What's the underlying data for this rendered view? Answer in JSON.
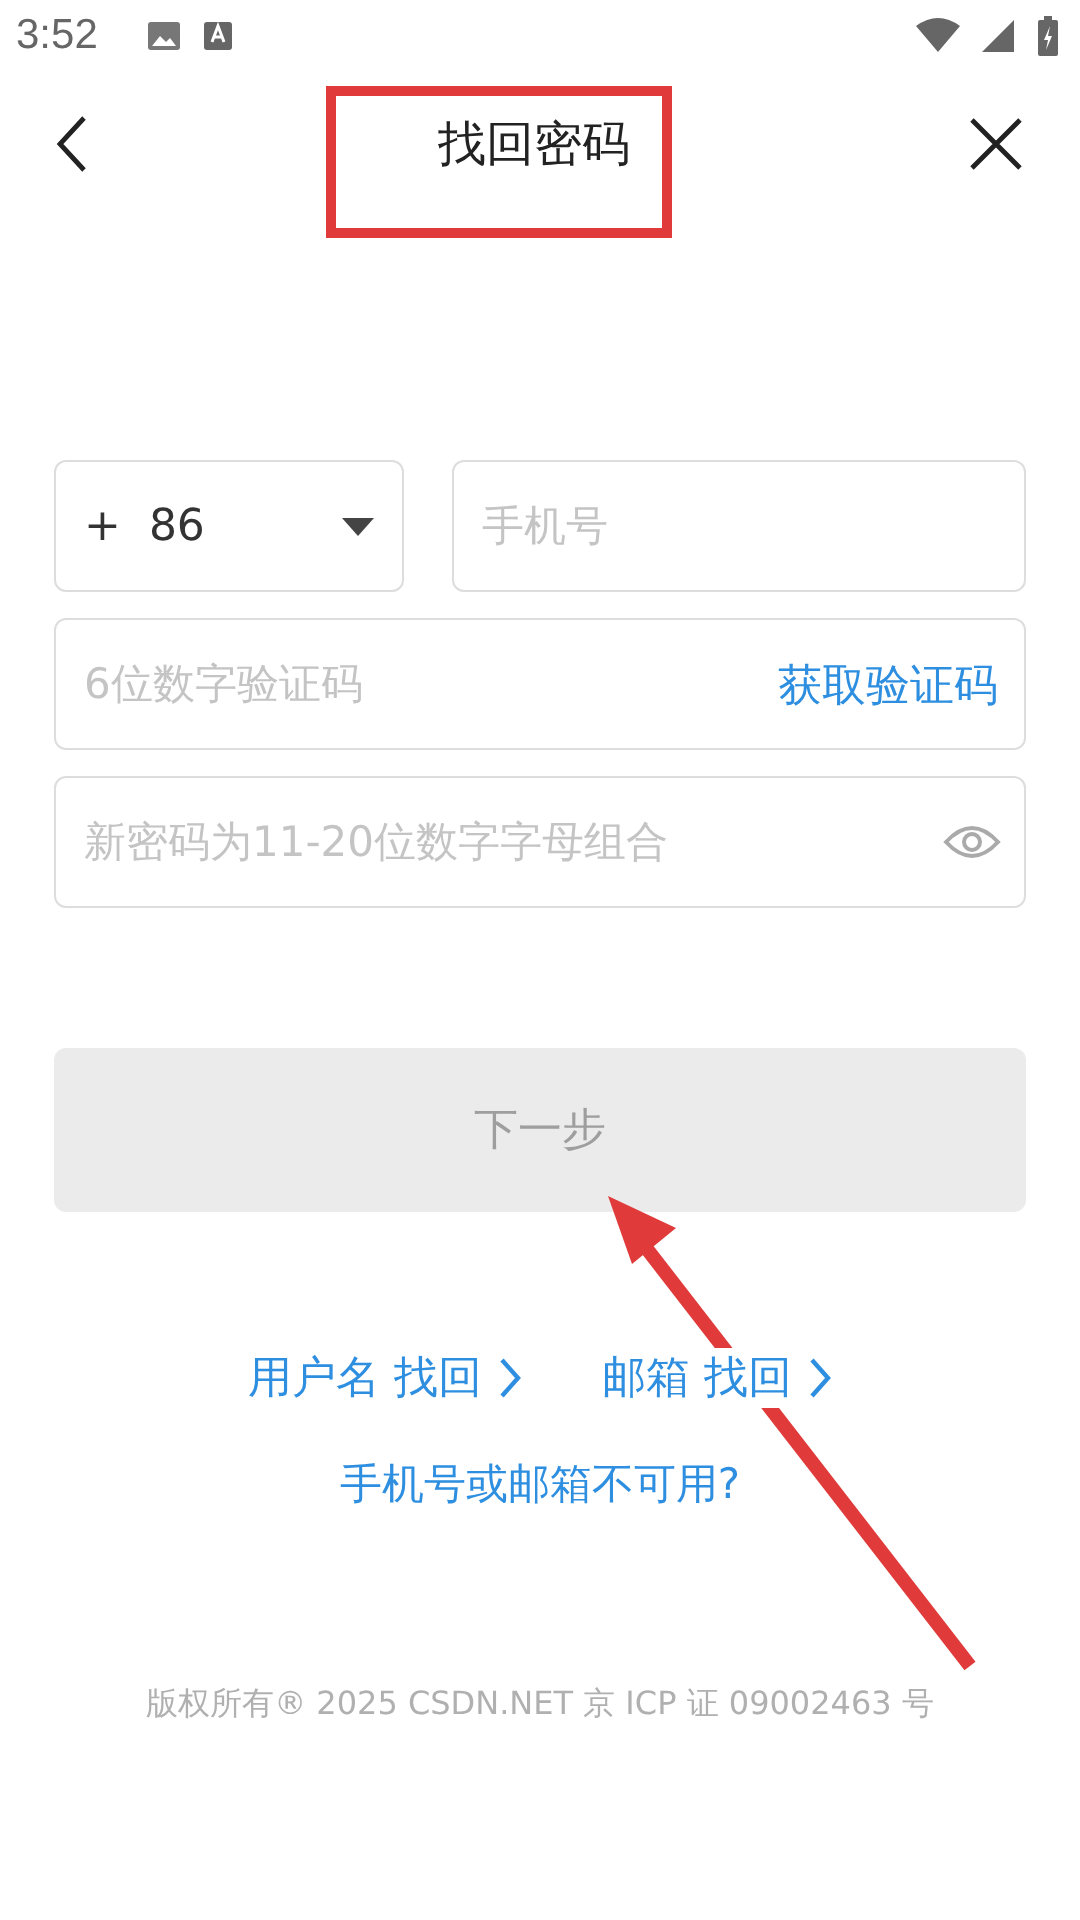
{
  "status_bar": {
    "time": "3:52"
  },
  "header": {
    "title": "找回密码"
  },
  "form": {
    "country": {
      "prefix": "+",
      "code": "86"
    },
    "phone": {
      "placeholder": "手机号"
    },
    "sms_code": {
      "placeholder": "6位数字验证码",
      "action": "获取验证码"
    },
    "password": {
      "placeholder": "新密码为11-20位数字字母组合"
    }
  },
  "next_button": {
    "label": "下一步",
    "disabled": true
  },
  "recover_links": [
    {
      "label": "用户名 找回"
    },
    {
      "label": "邮箱 找回"
    }
  ],
  "help_link": "手机号或邮箱不可用?",
  "footer": "版权所有® 2025 CSDN.NET 京 ICP 证 09002463 号"
}
